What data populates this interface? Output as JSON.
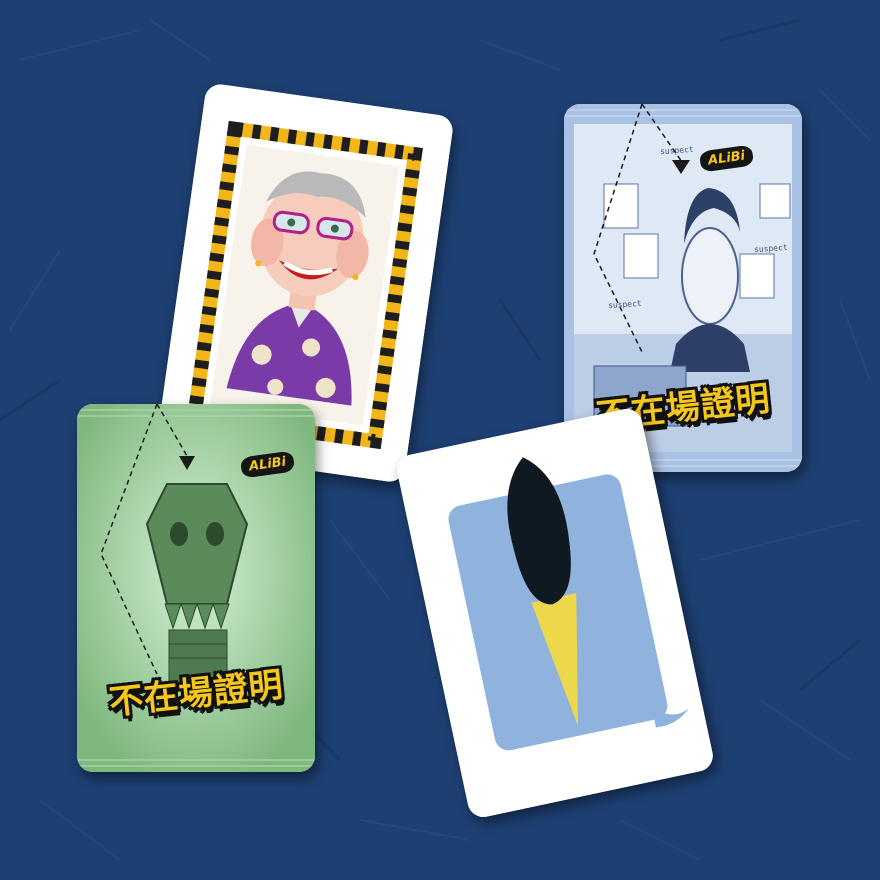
{
  "cards": {
    "suspect_woman": {
      "frame_colors": [
        "#f2b619",
        "#1e1e1e"
      ]
    },
    "alibi_blue": {
      "title": "不在場證明",
      "badge": "ALiBi",
      "suspect_tags": [
        "suspect",
        "suspect",
        "suspect"
      ],
      "tint": "#a9c1e4"
    },
    "alibi_green": {
      "title": "不在場證明",
      "badge": "ALiBi",
      "tint": "#8cc38c"
    },
    "speech_bubble": {
      "bubble_color": "#8fb3dd",
      "beak_color": "#ecd84a",
      "drop_color": "#0f1921"
    }
  },
  "colors": {
    "background": "#1d3f72",
    "title_yellow": "#f5c71e"
  }
}
